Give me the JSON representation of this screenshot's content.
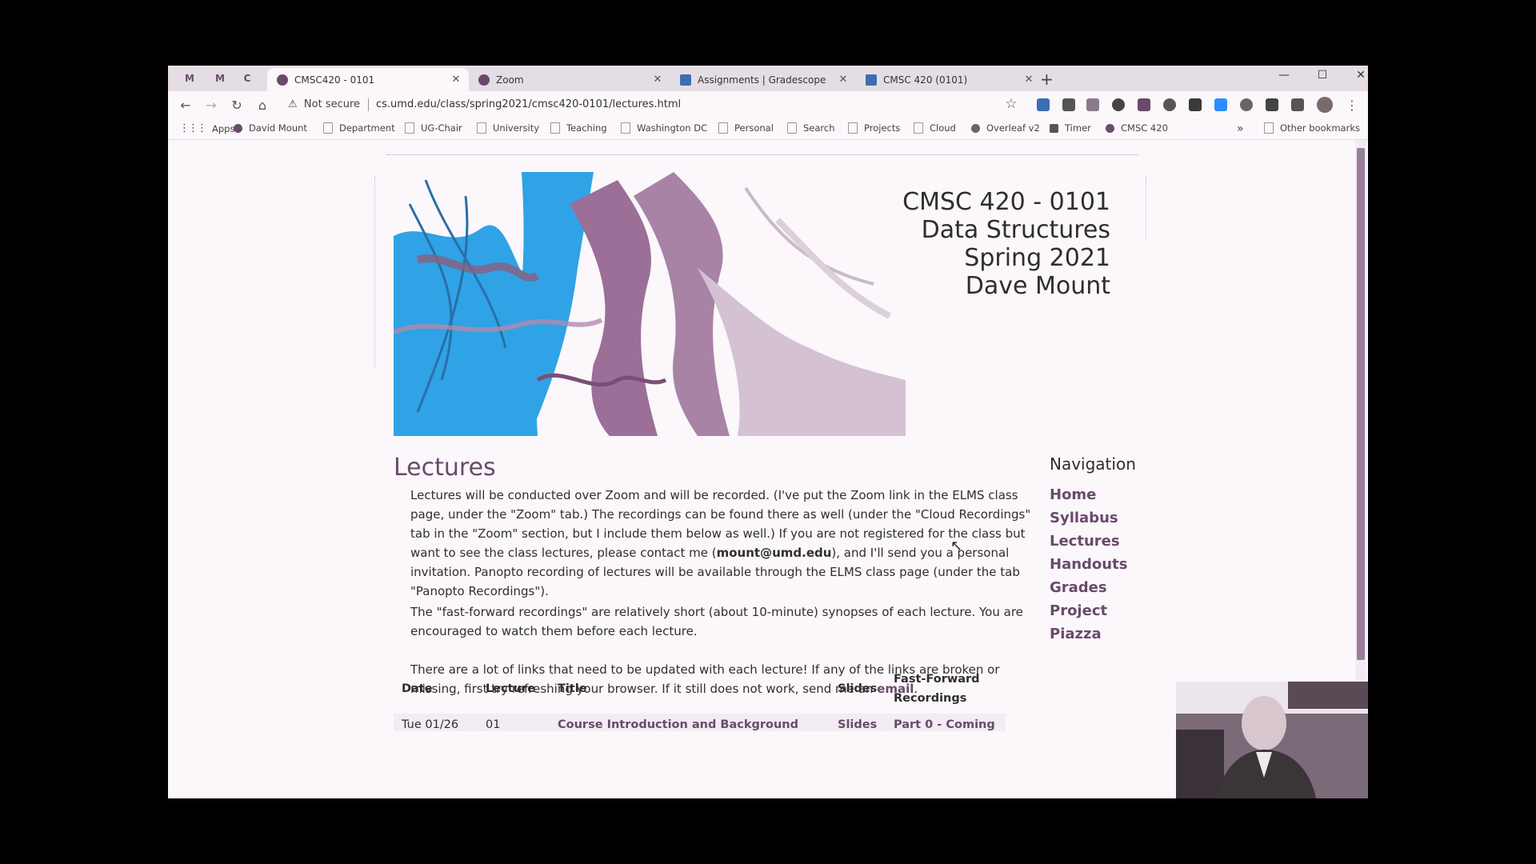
{
  "browser": {
    "pinned_tabs": [
      "M",
      "M",
      "C"
    ],
    "tabs": [
      {
        "title": "CMSC420 - 0101",
        "active": true
      },
      {
        "title": "Zoom",
        "active": false
      },
      {
        "title": "Assignments | Gradescope",
        "active": false
      },
      {
        "title": "CMSC 420 (0101)",
        "active": false
      }
    ],
    "new_tab_label": "+",
    "security_label": "Not secure",
    "url": "cs.umd.edu/class/spring2021/cmsc420-0101/lectures.html",
    "bookmarks": [
      "Apps",
      "David Mount",
      "Department",
      "UG-Chair",
      "University",
      "Teaching",
      "Washington DC",
      "Personal",
      "Search",
      "Projects",
      "Cloud",
      "Overleaf v2",
      "Timer",
      "CMSC 420"
    ],
    "bookmarks_overflow": "»",
    "other_bookmarks": "Other bookmarks"
  },
  "page": {
    "course_lines": [
      "CMSC 420 - 0101",
      "Data Structures",
      "Spring 2021",
      "Dave Mount"
    ],
    "heading": "Lectures",
    "para1_a": "Lectures will be conducted over Zoom and will be recorded. (I've put the Zoom link in the ELMS class page, under the \"Zoom\" tab.) The recordings can be found there as well (under the \"Cloud Recordings\" tab in the \"Zoom\" section, but I include them below as well.) If you are not registered for the class but want to see the class lectures, please contact me (",
    "para1_email": "mount@umd.edu",
    "para1_b": "), and I'll send you a personal invitation. Panopto recording of lectures will be available through the ELMS class page (under the tab \"Panopto Recordings\").",
    "para2": "The \"fast-forward recordings\" are relatively short (about 10-minute) synopses of each lecture. You are encouraged to watch them before each lecture.",
    "para3_a": "There are a lot of links that need to be updated with each lecture! If any of the links are broken or missing, first try refreshing your browser. If it still does not work, send me an ",
    "para3_email": "email",
    "para3_b": ".",
    "nav_heading": "Navigation",
    "nav_items": [
      "Home",
      "Syllabus",
      "Lectures",
      "Handouts",
      "Grades",
      "Project",
      "Piazza"
    ],
    "table": {
      "headers": [
        "Date",
        "Lecture",
        "Title",
        "Slides",
        "Fast-Forward Recordings"
      ],
      "row1": {
        "date": "Tue 01/26",
        "lecture": "01",
        "title": "Course Introduction and Background",
        "slides": "Slides",
        "ff": "Part 0 - Coming"
      }
    }
  }
}
